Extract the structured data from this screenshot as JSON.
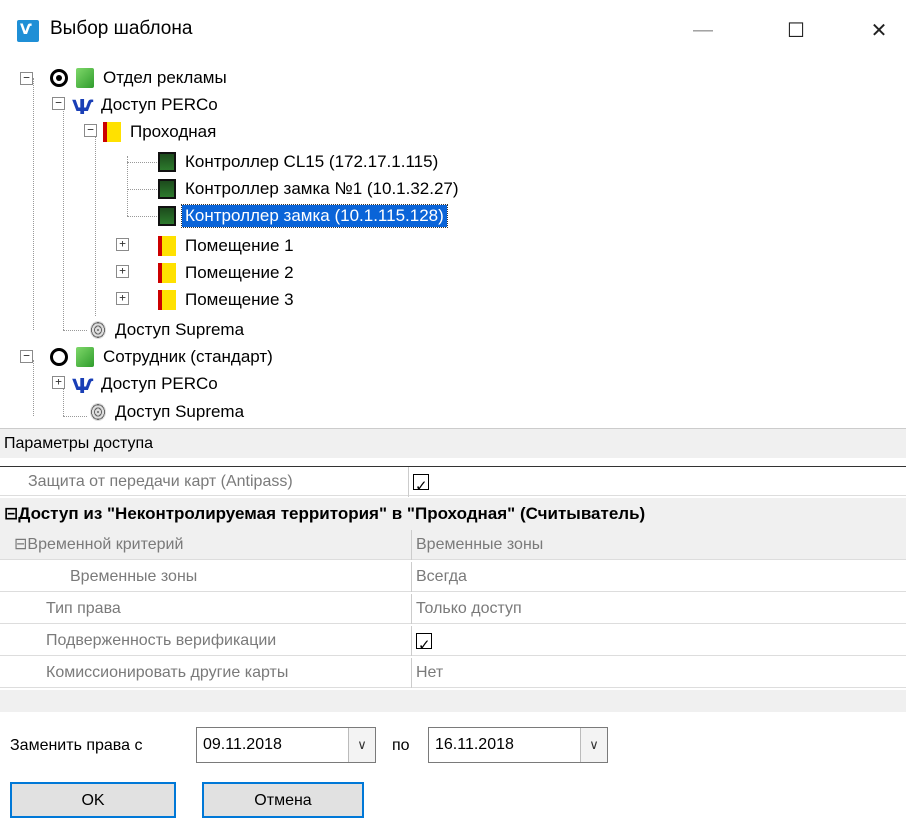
{
  "window": {
    "title": "Выбор шаблона",
    "app_icon_text": "Ѵ",
    "min": "—",
    "max": "☐",
    "close": "✕"
  },
  "tree": {
    "n1": "Отдел рекламы",
    "n2": "Доступ PERCo",
    "n3": "Проходная",
    "n4": "Контроллер CL15 (172.17.1.115)",
    "n5": "Контроллер замка №1 (10.1.32.27)",
    "n6": "Контроллер замка (10.1.115.128)",
    "n7": "Помещение 1",
    "n8": "Помещение 2",
    "n9": "Помещение 3",
    "n10": "Доступ Suprema",
    "n11": "Сотрудник (стандарт)",
    "n12": "Доступ PERCo",
    "n13": "Доступ Suprema"
  },
  "params": {
    "header": "Параметры доступа",
    "antipass_label": "Защита от передачи карт (Antipass)",
    "antipass_checked": true,
    "section_title": "⊟Доступ из \"Неконтролируемая территория\" в \"Проходная\" (Считыватель)",
    "rows": [
      {
        "key": "⊟Временной критерий",
        "value": "Временные зоны"
      },
      {
        "key": "Временные зоны",
        "value": "Всегда"
      },
      {
        "key": "Тип права",
        "value": "Только доступ"
      },
      {
        "key": "Подверженность верификации",
        "value": ""
      },
      {
        "key": "Комиссионировать другие карты",
        "value": "Нет"
      }
    ]
  },
  "footer": {
    "replace_label": "Заменить права с",
    "date_from": "09.11.2018",
    "to_label": "по",
    "date_to": "16.11.2018",
    "ok": "OK",
    "cancel": "Отмена"
  },
  "icons": {
    "expander_minus": "−",
    "expander_plus": "+",
    "dropdown": "∨"
  },
  "colors": {
    "selection": "#0a64d8",
    "button_border": "#0078d7"
  }
}
